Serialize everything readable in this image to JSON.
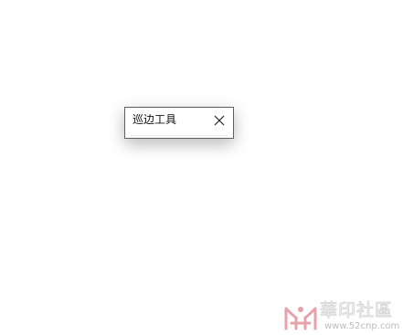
{
  "dialog": {
    "title": "巡边工具",
    "close_icon": "close-icon"
  },
  "watermark": {
    "title": "華印社區",
    "url": "www.52cnp.com",
    "logo_icon": "watermark-logo-icon",
    "logo_color": "#e7a1a8"
  }
}
